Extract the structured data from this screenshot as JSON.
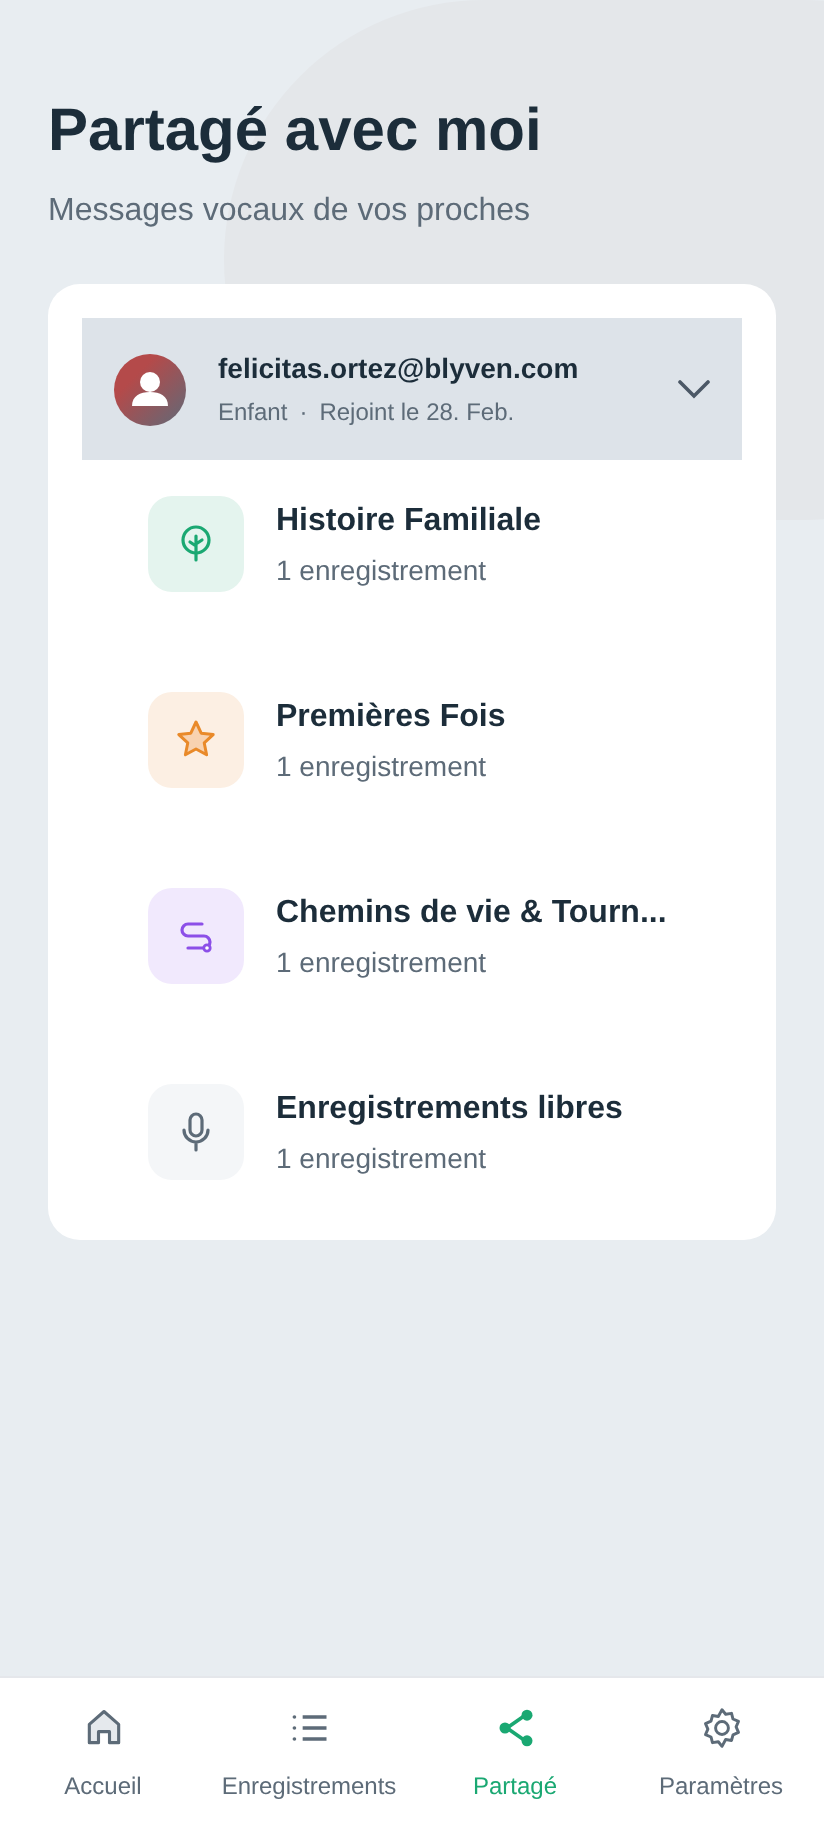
{
  "header": {
    "title": "Partagé avec moi",
    "subtitle": "Messages vocaux de vos proches"
  },
  "contact": {
    "email": "felicitas.ortez@blyven.com",
    "role": "Enfant",
    "separator": "·",
    "joined": "Rejoint le 28. Feb.",
    "expanded": true
  },
  "categories": [
    {
      "kind": "tree",
      "title": "Histoire Familiale",
      "count": "1 enregistrement"
    },
    {
      "kind": "star",
      "title": "Premières Fois",
      "count": "1 enregistrement"
    },
    {
      "kind": "path",
      "title": "Chemins de vie & Tourn...",
      "count": "1 enregistrement"
    },
    {
      "kind": "mic",
      "title": "Enregistrements libres",
      "count": "1 enregistrement"
    }
  ],
  "nav": [
    {
      "kind": "home",
      "label": "Accueil",
      "selected": false
    },
    {
      "kind": "list",
      "label": "Enregistrements",
      "selected": false
    },
    {
      "kind": "share",
      "label": "Partagé",
      "selected": true
    },
    {
      "kind": "gear",
      "label": "Paramètres",
      "selected": false
    }
  ]
}
